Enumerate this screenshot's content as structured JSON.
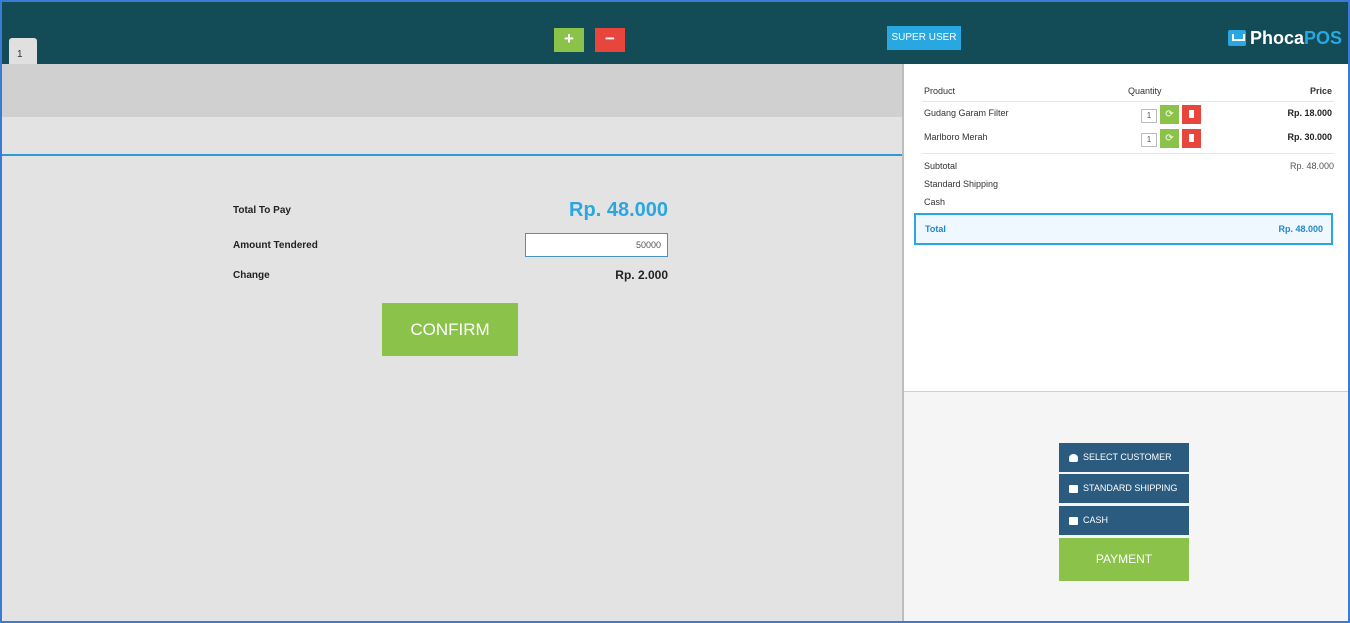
{
  "header": {
    "tab_label": "1",
    "add_label": "+",
    "remove_label": "−",
    "user_button": "SUPER USER",
    "brand_part1": "Phoca",
    "brand_part2": "POS"
  },
  "payment": {
    "total_label": "Total To Pay",
    "total_value": "Rp. 48.000",
    "tendered_label": "Amount Tendered",
    "tendered_value": "50000",
    "change_label": "Change",
    "change_value": "Rp. 2.000",
    "confirm_label": "CONFIRM"
  },
  "cart": {
    "headers": {
      "product": "Product",
      "quantity": "Quantity",
      "price": "Price"
    },
    "items": [
      {
        "name": "Gudang Garam Filter",
        "qty": "1",
        "price": "Rp. 18.000"
      },
      {
        "name": "Marlboro Merah",
        "qty": "1",
        "price": "Rp. 30.000"
      }
    ],
    "subtotal_label": "Subtotal",
    "subtotal_value": "Rp. 48.000",
    "shipping_label": "Standard Shipping",
    "cash_label": "Cash",
    "total_label": "Total",
    "total_value": "Rp. 48.000"
  },
  "actions": {
    "select_customer": "SELECT CUSTOMER",
    "standard_shipping": "STANDARD SHIPPING",
    "cash": "CASH",
    "payment": "PAYMENT"
  },
  "colors": {
    "header_bg": "#134b56",
    "accent_blue": "#29a7e0",
    "green": "#8bc34a",
    "red": "#e8453c",
    "action_blue": "#2b5b7e"
  }
}
